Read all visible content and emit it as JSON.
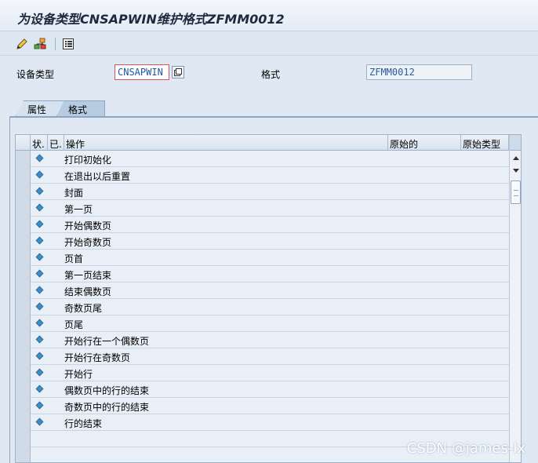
{
  "title": "为设备类型CNSAPWIN维护格式ZFMM0012",
  "toolbar": {
    "icons": [
      "pencil-icon",
      "hierarchy-icon",
      "list-icon"
    ]
  },
  "fields": {
    "device_type_label": "设备类型",
    "device_type_value": "CNSAPWIN",
    "format_label": "格式",
    "format_value": "ZFMM0012"
  },
  "tabs": [
    {
      "label": "属性",
      "selected": false
    },
    {
      "label": "格式",
      "selected": true
    }
  ],
  "table": {
    "columns": [
      "状.",
      "已.",
      "操作",
      "原始的",
      "原始类型"
    ],
    "rows": [
      "打印初始化",
      "在退出以后重置",
      "封面",
      "第一页",
      "开始偶数页",
      "开始奇数页",
      "页首",
      "第一页结束",
      "结束偶数页",
      "奇数页尾",
      "页尾",
      "开始行在一个偶数页",
      "开始行在奇数页",
      "开始行",
      "偶数页中的行的结束",
      "奇数页中的行的结束",
      "行的结束",
      "",
      ""
    ],
    "status_color": "#3c8fc7"
  },
  "watermark": "CSDN @james-lx"
}
